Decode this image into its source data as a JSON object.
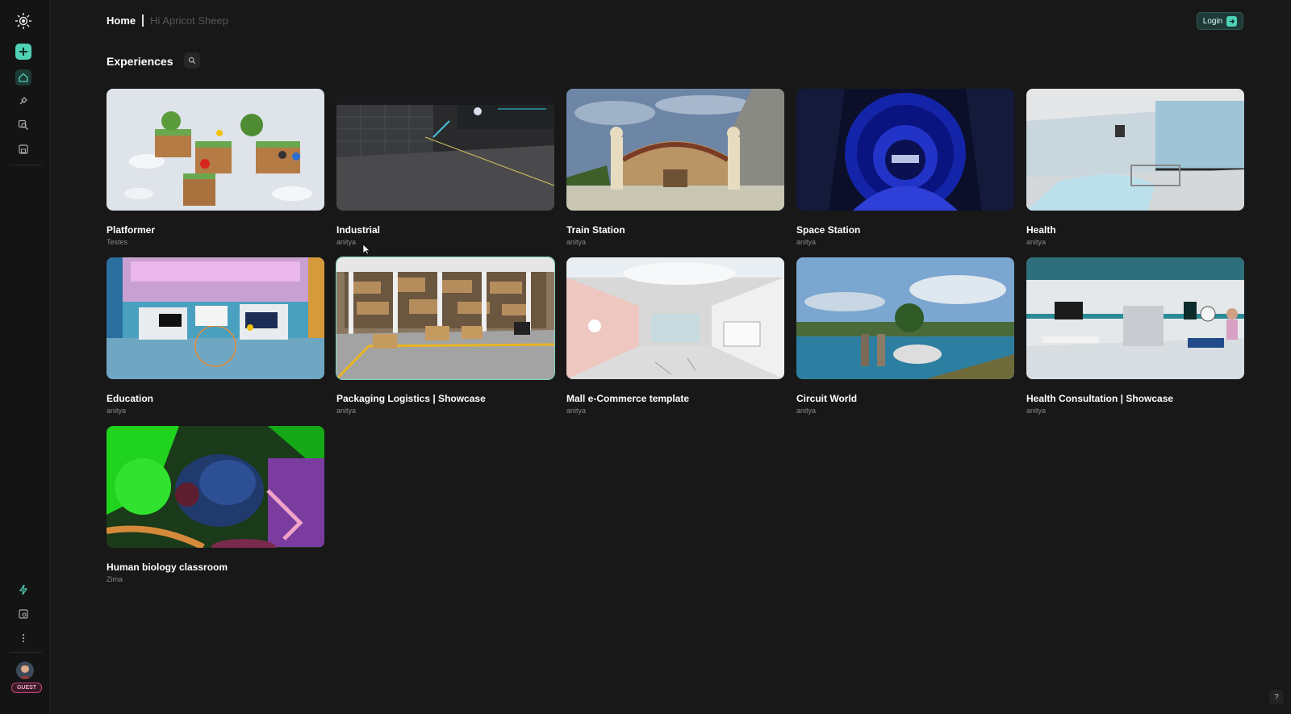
{
  "header": {
    "home_label": "Home",
    "greeting": "Hi Apricot Sheep"
  },
  "login": {
    "label": "Login"
  },
  "main": {
    "section_title": "Experiences"
  },
  "sidebar": {
    "items": [
      {
        "name": "new",
        "icon": "plus-icon"
      },
      {
        "name": "home",
        "icon": "home-icon"
      },
      {
        "name": "edit",
        "icon": "brush-icon"
      },
      {
        "name": "search",
        "icon": "search-icon"
      },
      {
        "name": "library",
        "icon": "save-icon"
      }
    ],
    "bottom_items": [
      {
        "name": "activity",
        "icon": "lightning-icon"
      },
      {
        "name": "settings",
        "icon": "settings-icon"
      },
      {
        "name": "more",
        "icon": "more-vertical-icon"
      }
    ],
    "badge": "GUEST"
  },
  "cards": [
    {
      "title": "Platformer",
      "author": "Testes"
    },
    {
      "title": "Industrial",
      "author": "anitya"
    },
    {
      "title": "Train Station",
      "author": "anitya"
    },
    {
      "title": "Space Station",
      "author": "anitya"
    },
    {
      "title": "Health",
      "author": "anitya"
    },
    {
      "title": "Education",
      "author": "anitya"
    },
    {
      "title": "Packaging Logistics | Showcase",
      "author": "anitya"
    },
    {
      "title": "Mall e-Commerce template",
      "author": "anitya"
    },
    {
      "title": "Circuit World",
      "author": "anitya"
    },
    {
      "title": "Health Consultation | Showcase",
      "author": "anitya"
    },
    {
      "title": "Human biology classroom",
      "author": "Zima"
    }
  ],
  "help": {
    "label": "?"
  },
  "colors": {
    "accent": "#4fd1b5",
    "background": "#181818",
    "sidebar": "#141414"
  }
}
